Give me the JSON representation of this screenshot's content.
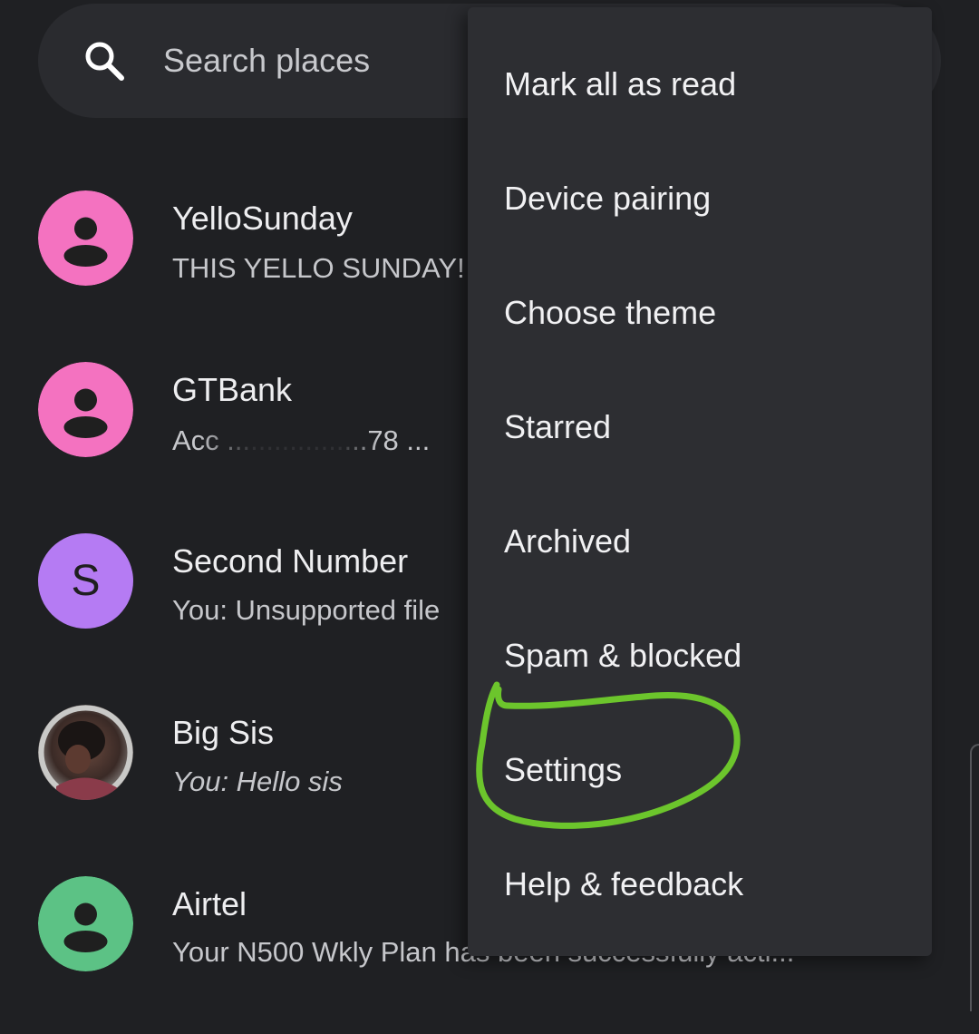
{
  "search": {
    "placeholder": "Search places"
  },
  "conversations": [
    {
      "name": "YelloSunday",
      "snippet": "THIS YELLO SUNDAY!",
      "avatar_type": "person-icon",
      "avatar_color": "#f472c0"
    },
    {
      "name": "GTBank",
      "snippet": "Acc ..................78 ...",
      "avatar_type": "person-icon",
      "avatar_color": "#f472c0"
    },
    {
      "name": "Second Number",
      "snippet": "You: Unsupported file",
      "avatar_type": "letter",
      "avatar_letter": "S",
      "avatar_color": "#b57bf3"
    },
    {
      "name": "Big Sis",
      "snippet": "You: Hello sis",
      "avatar_type": "photo"
    },
    {
      "name": "Airtel",
      "snippet": "Your N500 Wkly Plan has been successfully acti...",
      "avatar_type": "person-icon",
      "avatar_color": "#5cc285"
    }
  ],
  "menu": {
    "items": [
      {
        "label": "Mark all as read"
      },
      {
        "label": "Device pairing"
      },
      {
        "label": "Choose theme"
      },
      {
        "label": "Starred"
      },
      {
        "label": "Archived"
      },
      {
        "label": "Spam & blocked"
      },
      {
        "label": "Settings",
        "highlighted": true
      },
      {
        "label": "Help & feedback"
      }
    ]
  },
  "colors": {
    "background": "#1f2023",
    "menu_background": "#2d2e32",
    "annotation_circle": "#6cc52c"
  }
}
